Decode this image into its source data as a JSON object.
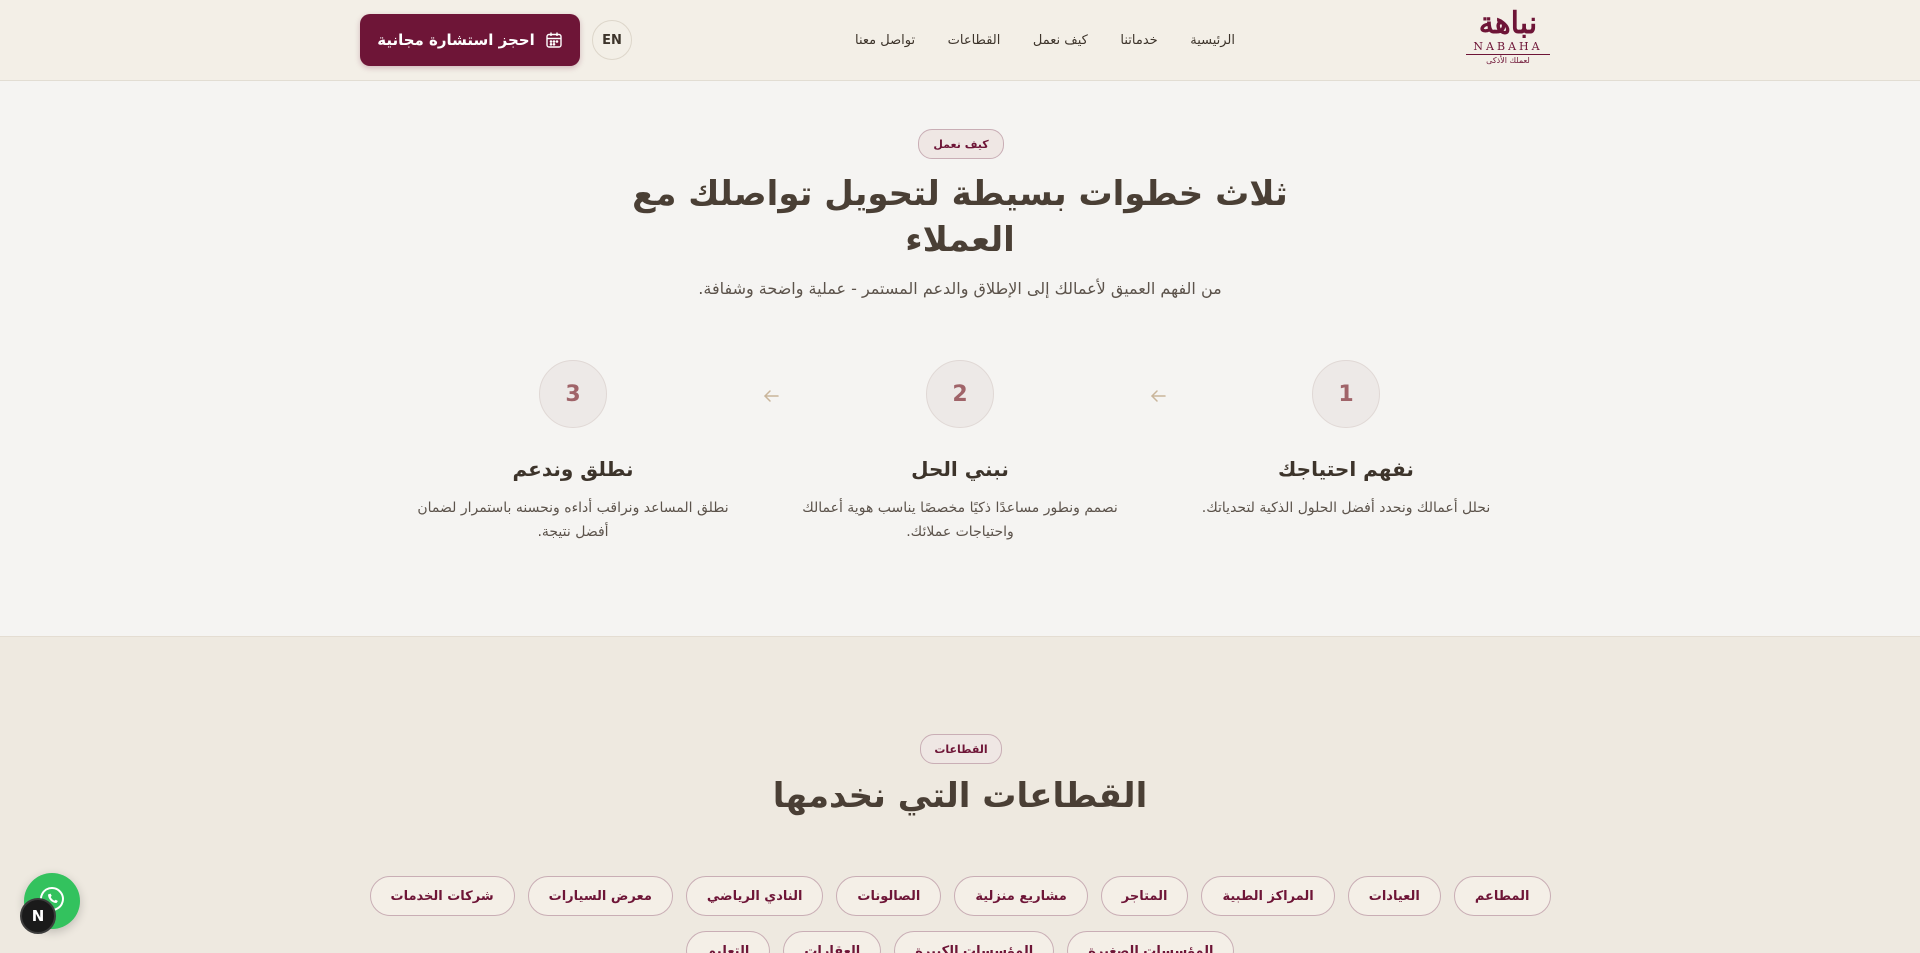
{
  "header": {
    "logo": {
      "arabic": "نباهة",
      "english": "NABAHA",
      "tagline": "لعملك الأذكى"
    },
    "nav": [
      {
        "label": "الرئيسية"
      },
      {
        "label": "خدماتنا"
      },
      {
        "label": "كيف نعمل"
      },
      {
        "label": "القطاعات"
      },
      {
        "label": "تواصل معنا"
      }
    ],
    "lang_label": "EN",
    "cta_label": "احجز استشارة مجانية",
    "cta_icon": "calendar-icon"
  },
  "how_it_works": {
    "pill": "كيف نعمل",
    "title_line1": "ثلاث خطوات بسيطة لتحويل تواصلك مع",
    "title_line2": "العملاء",
    "subtitle": "من الفهم العميق لأعمالك إلى الإطلاق والدعم المستمر - عملية واضحة وشفافة.",
    "steps": [
      {
        "number": "1",
        "title": "نفهم احتياجك",
        "description": "نحلل أعمالك ونحدد أفضل الحلول الذكية لتحدياتك."
      },
      {
        "number": "2",
        "title": "نبني الحل",
        "description": "نصمم ونطور مساعدًا ذكيًا مخصصًا يناسب هوية أعمالك واحتياجات عملائك."
      },
      {
        "number": "3",
        "title": "نطلق وندعم",
        "description": "نطلق المساعد ونراقب أداءه ونحسنه باستمرار لضمان أفضل نتيجة."
      }
    ],
    "arrow_icon": "arrow-left-icon"
  },
  "sectors": {
    "pill": "القطاعات",
    "title": "القطاعات التي نخدمها",
    "row1": [
      {
        "label": "المطاعم"
      },
      {
        "label": "العيادات"
      },
      {
        "label": "المراكز الطبية"
      },
      {
        "label": "المتاجر"
      },
      {
        "label": "مشاريع منزلية"
      },
      {
        "label": "الصالونات"
      },
      {
        "label": "النادي الرياضي"
      },
      {
        "label": "معرض السيارات"
      },
      {
        "label": "شركات الخدمات"
      }
    ],
    "row2": [
      {
        "label": "المؤسسات الصغيرة"
      },
      {
        "label": "المؤسسات الكبيرة"
      },
      {
        "label": "العقارات"
      },
      {
        "label": "التعليم"
      }
    ]
  },
  "widgets": {
    "whatsapp_icon": "whatsapp-icon",
    "badge_letter": "N"
  },
  "colors": {
    "brand": "#6e1537",
    "header_bg": "#f3efe7",
    "section_bg": "#f5f4f2",
    "sectors_bg": "#eee9e0",
    "step_number": "#a06469",
    "whatsapp": "#33c25e"
  }
}
